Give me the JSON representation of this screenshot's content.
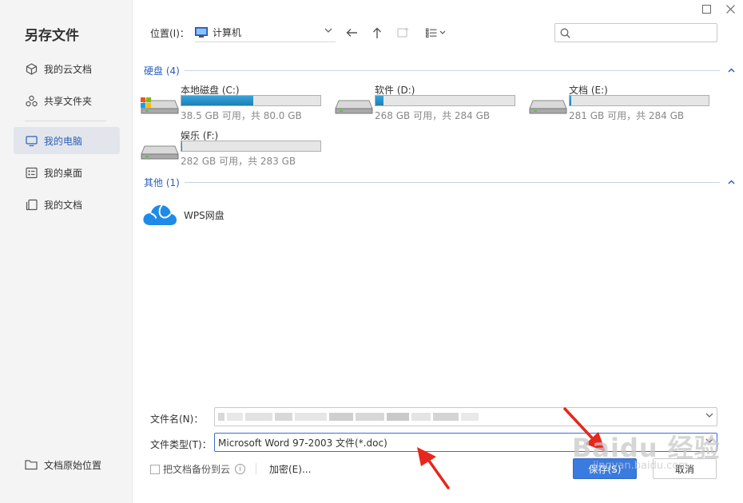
{
  "dialog": {
    "title": "另存文件"
  },
  "window_controls": {
    "maximize_icon": "maximize-icon",
    "close_icon": "close-icon"
  },
  "sidebar": {
    "items": [
      {
        "label": "我的云文档",
        "icon": "cloud-doc-icon"
      },
      {
        "label": "共享文件夹",
        "icon": "share-folder-icon"
      },
      {
        "label": "我的电脑",
        "icon": "computer-icon",
        "active": true
      },
      {
        "label": "我的桌面",
        "icon": "desktop-icon"
      },
      {
        "label": "我的文档",
        "icon": "documents-icon"
      }
    ],
    "original_location": "文档原始位置"
  },
  "toolbar": {
    "location_label": "位置(I)：",
    "location_value": "计算机",
    "search_placeholder": ""
  },
  "groups": {
    "hard_disks": {
      "label": "硬盘 (4)"
    },
    "other": {
      "label": "其他 (1)"
    }
  },
  "drives": [
    {
      "name": "本地磁盘 (C:)",
      "free_text": "38.5 GB 可用，共 80.0 GB",
      "used_fraction": 0.52,
      "windows_logo": true
    },
    {
      "name": "软件 (D:)",
      "free_text": "268 GB 可用，共 284 GB",
      "used_fraction": 0.056
    },
    {
      "name": "文档 (E:)",
      "free_text": "281 GB 可用，共 284 GB",
      "used_fraction": 0.011
    },
    {
      "name": "娱乐 (F:)",
      "free_text": "282 GB 可用，共 283 GB",
      "used_fraction": 0.004
    }
  ],
  "other_items": [
    {
      "name": "WPS网盘",
      "icon": "wps-cloud-icon"
    }
  ],
  "form": {
    "filename_label": "文件名(N)：",
    "filetype_label": "文件类型(T)：",
    "filetype_value": "Microsoft Word 97-2003 文件(*.doc)",
    "backup_label": "把文档备份到云",
    "encrypt_label": "加密(E)...",
    "save_label": "保存(S)",
    "cancel_label": "取消"
  },
  "colors": {
    "accent": "#2b5fb8",
    "save_button": "#3a7be0",
    "arrow": "#e8261d"
  }
}
